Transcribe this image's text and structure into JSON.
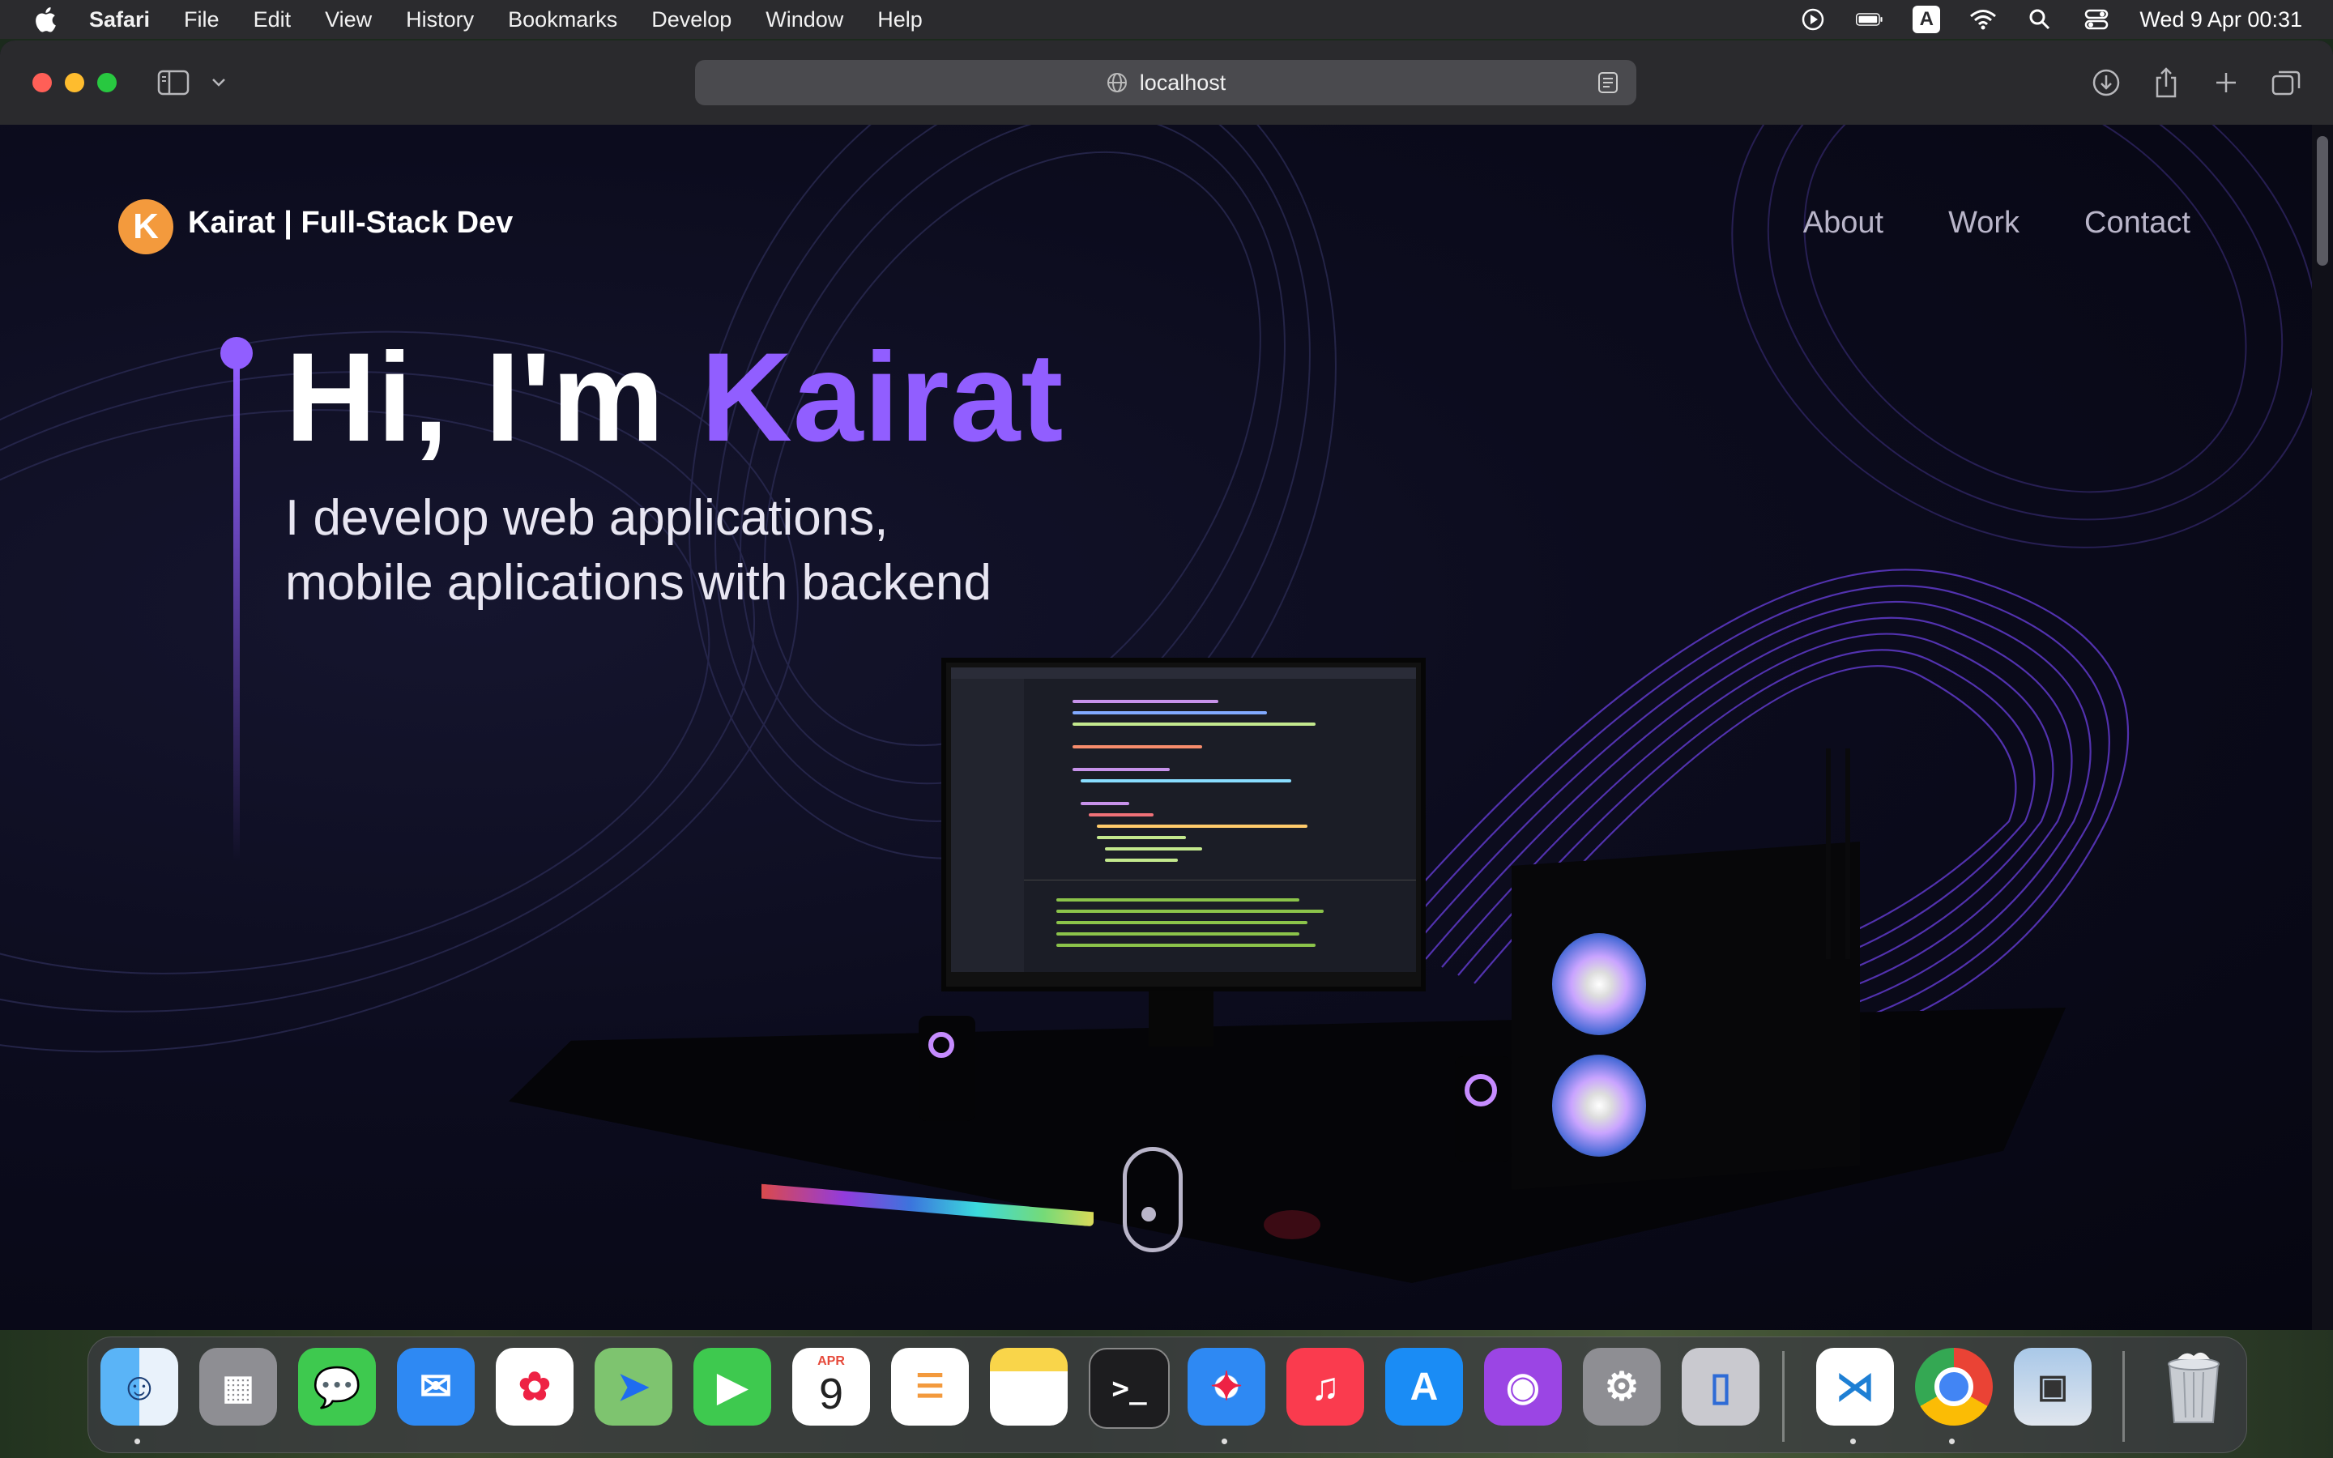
{
  "menubar": {
    "app_name": "Safari",
    "menus": [
      "File",
      "Edit",
      "View",
      "History",
      "Bookmarks",
      "Develop",
      "Window",
      "Help"
    ],
    "clock": "Wed 9 Apr  00:31",
    "keyboard_input": "A",
    "status_icons": [
      "play-circle-icon",
      "battery-icon",
      "input-source-icon",
      "wifi-icon",
      "spotlight-search-icon",
      "control-center-icon"
    ]
  },
  "browser": {
    "url": "localhost",
    "toolbar_icons": [
      "sidebar-icon",
      "chevron-down-icon",
      "globe-icon",
      "reader-icon",
      "download-icon",
      "share-icon",
      "new-tab-icon",
      "tab-overview-icon"
    ]
  },
  "site": {
    "logo_letter": "K",
    "brand": "Kairat | Full-Stack Dev",
    "nav": [
      "About",
      "Work",
      "Contact"
    ],
    "hero_greeting": "Hi, I'm ",
    "hero_name": "Kairat",
    "hero_subtitle_line1": "I develop web applications,",
    "hero_subtitle_line2": "mobile aplications with backend",
    "accent_color": "#915eff"
  },
  "dock": {
    "apps": [
      "Finder",
      "Launchpad",
      "Messages",
      "Mail",
      "Photos",
      "Maps",
      "FaceTime",
      "Calendar",
      "Reminders",
      "Notes",
      "Terminal",
      "Safari",
      "Music",
      "App Store",
      "Podcasts",
      "System Settings",
      "iPhone Mirroring",
      "Visual Studio Code",
      "Google Chrome",
      "Preview",
      "Trash"
    ],
    "calendar_month": "APR",
    "calendar_day": "9"
  }
}
